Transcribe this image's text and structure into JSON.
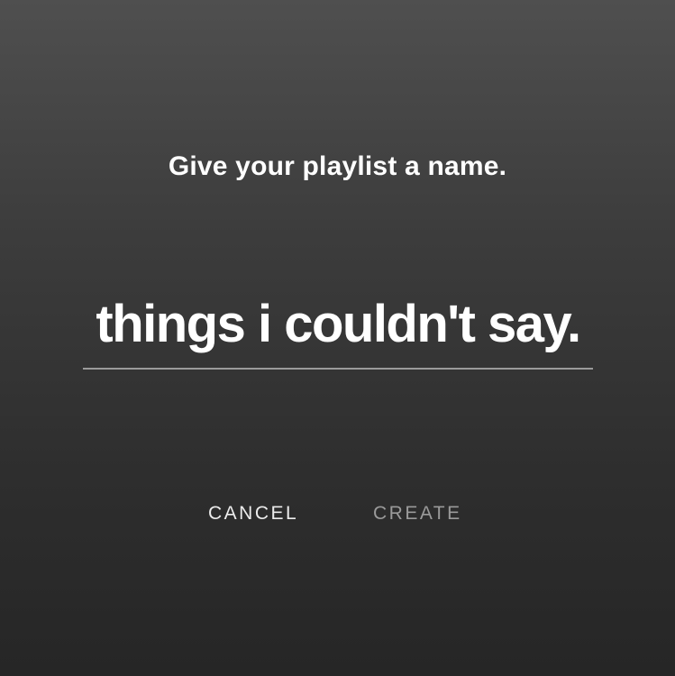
{
  "dialog": {
    "prompt": "Give your playlist a name.",
    "name_value": "things i couldn't say.",
    "cancel_label": "CANCEL",
    "create_label": "CREATE"
  },
  "colors": {
    "background_top": "#4f4f4f",
    "background_bottom": "#262626",
    "text_primary": "#ffffff",
    "underline": "#9a9a9a",
    "button_disabled": "#9a9a9a"
  }
}
